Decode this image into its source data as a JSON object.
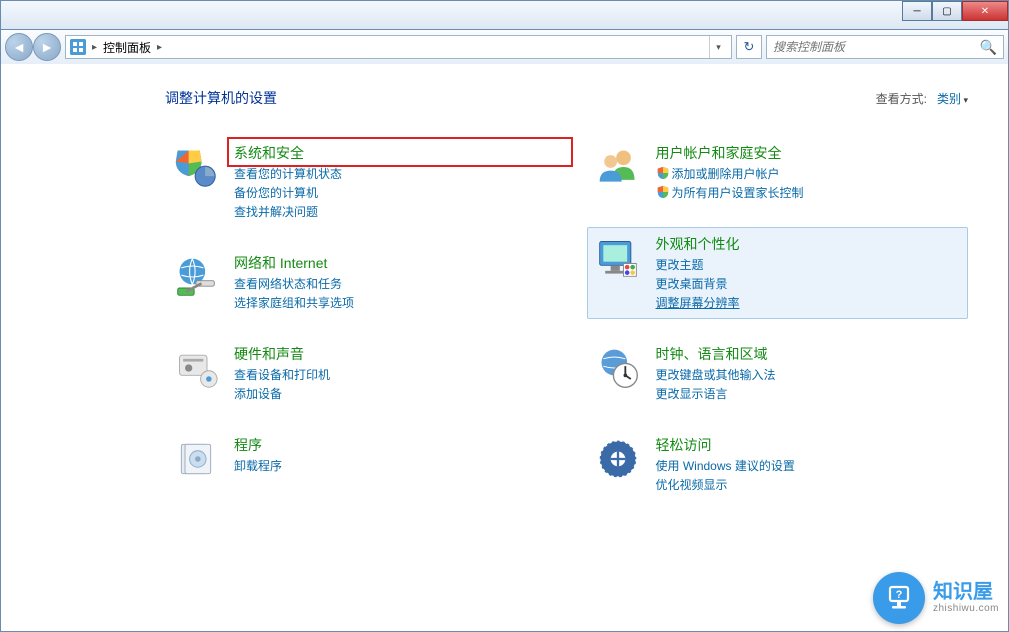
{
  "address_bar": {
    "path": "控制面板",
    "separator": "▸"
  },
  "search": {
    "placeholder": "搜索控制面板"
  },
  "page": {
    "title": "调整计算机的设置",
    "view_by_label": "查看方式:",
    "view_by_value": "类别"
  },
  "categories": {
    "left": [
      {
        "title": "系统和安全",
        "links": [
          "查看您的计算机状态",
          "备份您的计算机",
          "查找并解决问题"
        ],
        "highlight": true
      },
      {
        "title": "网络和 Internet",
        "links": [
          "查看网络状态和任务",
          "选择家庭组和共享选项"
        ]
      },
      {
        "title": "硬件和声音",
        "links": [
          "查看设备和打印机",
          "添加设备"
        ]
      },
      {
        "title": "程序",
        "links": [
          "卸载程序"
        ]
      }
    ],
    "right": [
      {
        "title": "用户帐户和家庭安全",
        "links": [
          {
            "text": "添加或删除用户帐户",
            "shield": true
          },
          {
            "text": "为所有用户设置家长控制",
            "shield": true
          }
        ]
      },
      {
        "title": "外观和个性化",
        "links": [
          "更改主题",
          "更改桌面背景",
          "调整屏幕分辨率"
        ],
        "hovered": true,
        "underline_idx": 2
      },
      {
        "title": "时钟、语言和区域",
        "links": [
          "更改键盘或其他输入法",
          "更改显示语言"
        ]
      },
      {
        "title": "轻松访问",
        "links": [
          "使用 Windows 建议的设置",
          "优化视频显示"
        ]
      }
    ]
  },
  "watermark": {
    "brand": "知识屋",
    "domain": "zhishiwu.com"
  }
}
